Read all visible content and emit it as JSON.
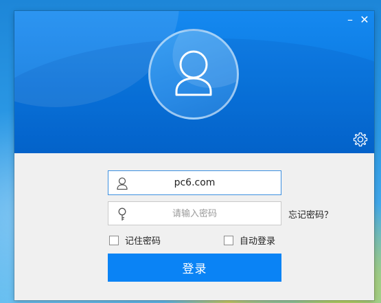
{
  "window": {
    "minimize_label": "–",
    "close_label": "✕",
    "accent_color": "#0a83f5",
    "banner_color": "#0a78e0"
  },
  "login": {
    "avatar_icon": "user-icon",
    "settings_icon": "gear-icon",
    "username_icon": "user-outline-icon",
    "password_icon": "key-icon",
    "username_value": "pc6.com",
    "password_placeholder": "请输入密码",
    "password_value": "",
    "forgot_password_label": "忘记密码？",
    "remember_password_label": "记住密码",
    "remember_password_checked": false,
    "auto_login_label": "自动登录",
    "auto_login_checked": false,
    "login_button_label": "登录"
  }
}
